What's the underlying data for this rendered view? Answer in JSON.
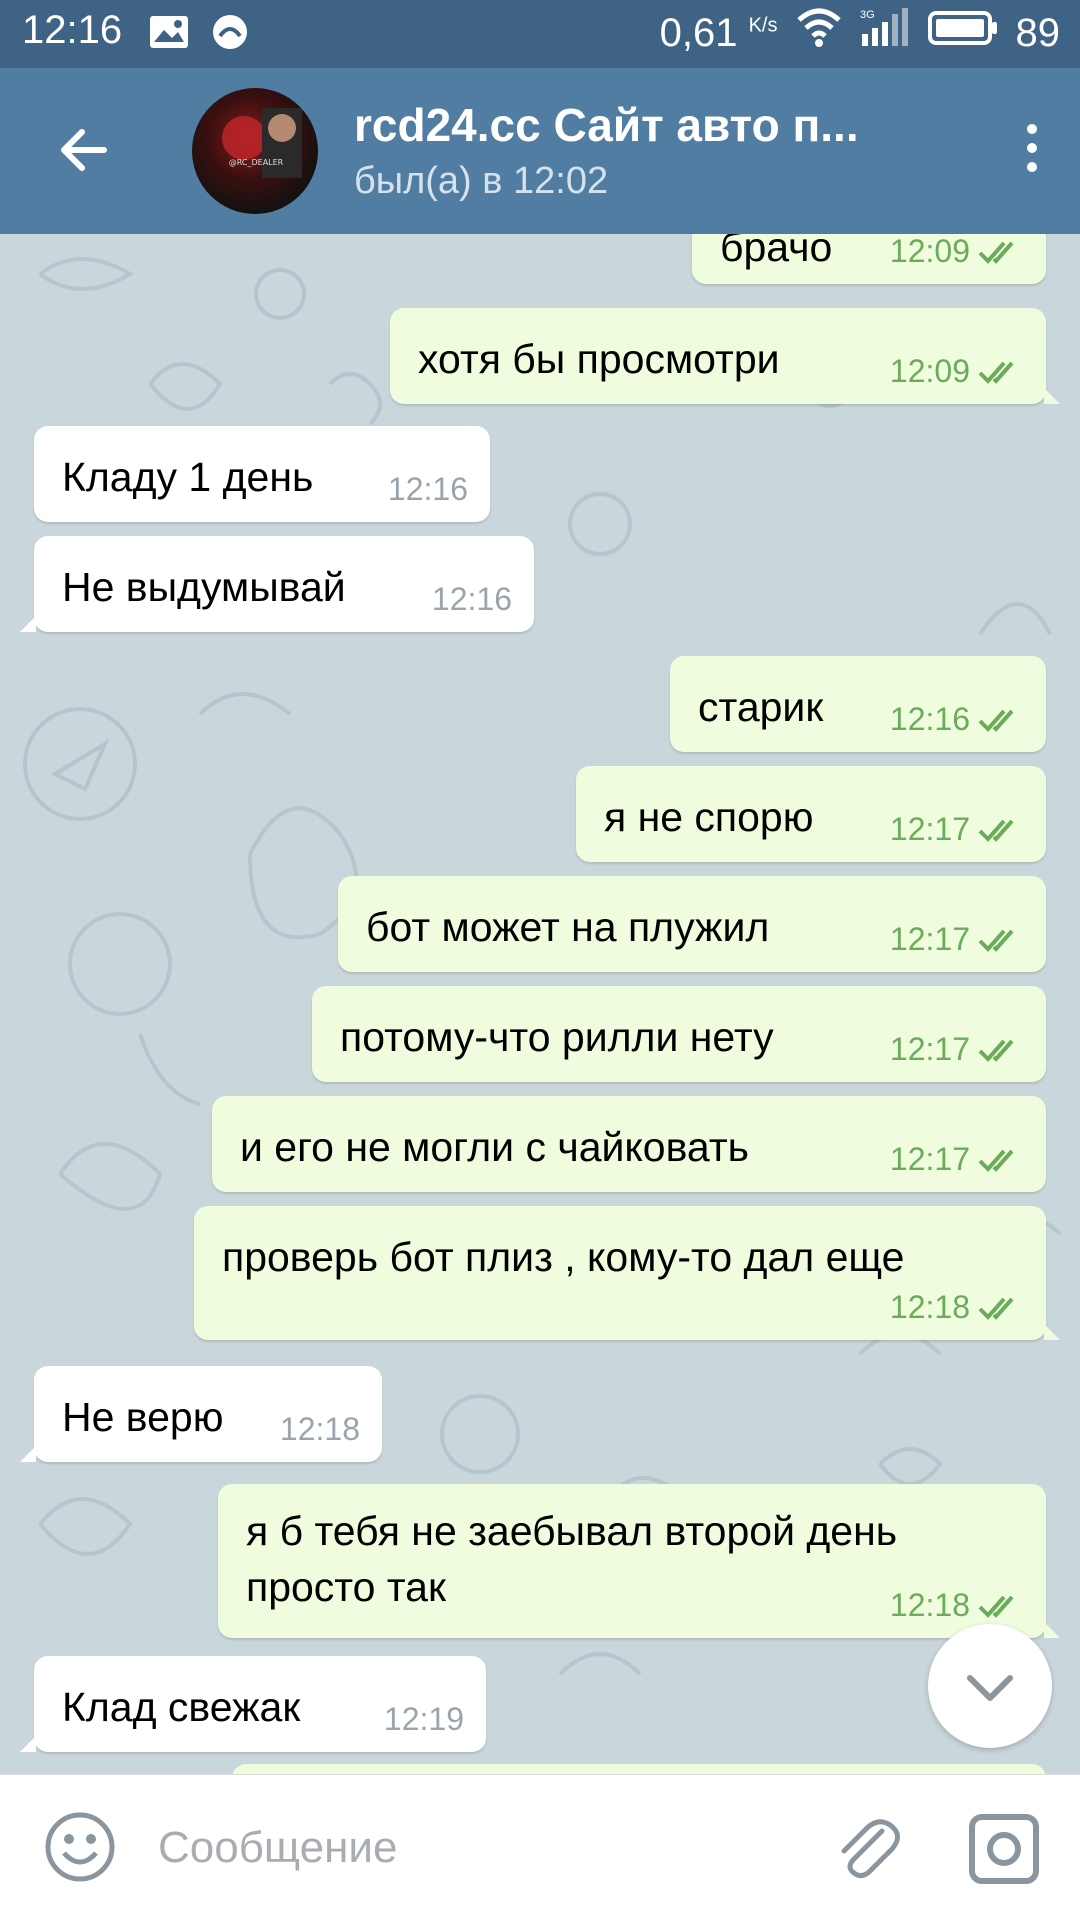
{
  "status_bar": {
    "time": "12:16",
    "net_speed": "0,61",
    "net_speed_unit": "K/s",
    "battery": "89",
    "network_type": "3G"
  },
  "header": {
    "title": "rcd24.cc Сайт авто п...",
    "subtitle": "был(а) в 12:02",
    "avatar_text": "@RC_DEALER"
  },
  "messages": [
    {
      "dir": "out",
      "text": "брачо",
      "time": "12:09",
      "read": true
    },
    {
      "dir": "out",
      "text": "хотя бы просмотри",
      "time": "12:09",
      "read": true
    },
    {
      "dir": "in",
      "text": "Кладу 1 день",
      "time": "12:16"
    },
    {
      "dir": "in",
      "text": "Не выдумывай",
      "time": "12:16"
    },
    {
      "dir": "out",
      "text": "старик",
      "time": "12:16",
      "read": true
    },
    {
      "dir": "out",
      "text": "я не спорю",
      "time": "12:17",
      "read": true
    },
    {
      "dir": "out",
      "text": "бот может на плужил",
      "time": "12:17",
      "read": true
    },
    {
      "dir": "out",
      "text": "потому-что рилли нету",
      "time": "12:17",
      "read": true
    },
    {
      "dir": "out",
      "text": "и его не могли с чайковать",
      "time": "12:17",
      "read": true
    },
    {
      "dir": "out",
      "text": "проверь бот плиз , кому-то дал еще",
      "time": "12:18",
      "read": true
    },
    {
      "dir": "in",
      "text": "Не верю",
      "time": "12:18"
    },
    {
      "dir": "out",
      "text": "я б тебя не заебывал второй день\nпросто так",
      "line1": "я б тебя не заебывал второй день",
      "line2": "просто так",
      "time": "12:18",
      "read": true
    },
    {
      "dir": "in",
      "text": "Клад свежак",
      "time": "12:19"
    }
  ],
  "composer": {
    "placeholder": "Сообщение"
  },
  "colors": {
    "header": "#517da2",
    "status_bar": "#3f6384",
    "outgoing_bubble": "#effdde",
    "incoming_bubble": "#ffffff",
    "check_color": "#6bab5a"
  }
}
